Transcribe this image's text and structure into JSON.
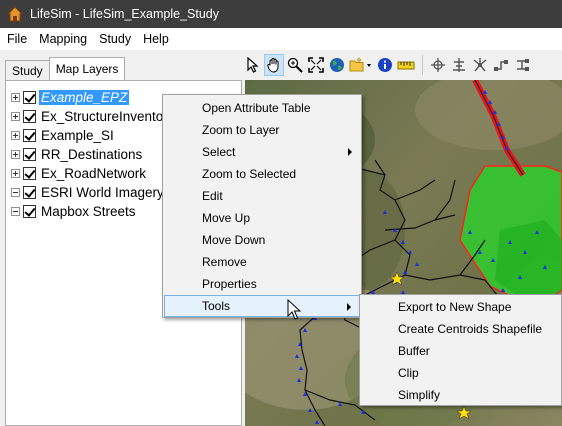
{
  "window": {
    "title": "LifeSim - LifeSim_Example_Study"
  },
  "menubar": {
    "items": [
      "File",
      "Mapping",
      "Study",
      "Help"
    ]
  },
  "tabs": [
    {
      "label": "Study",
      "active": false
    },
    {
      "label": "Map Layers",
      "active": true
    }
  ],
  "toolbar": {
    "tools": [
      "select-arrow-icon",
      "pan-hand-icon",
      "zoom-in-icon",
      "zoom-extent-icon",
      "globe-icon",
      "add-layer-icon",
      "info-icon",
      "measure-ruler-icon",
      "crosshair-icon",
      "flow-icon",
      "burst-icon",
      "route-icon",
      "network-icon"
    ],
    "selected_tool": "pan-hand-icon"
  },
  "layers": [
    {
      "label": "Example_EPZ",
      "checked": true,
      "expanded": false,
      "selected": true
    },
    {
      "label": "Ex_StructureInventory",
      "checked": true,
      "expanded": false,
      "selected": false
    },
    {
      "label": "Example_SI",
      "checked": true,
      "expanded": false,
      "selected": false
    },
    {
      "label": "RR_Destinations",
      "checked": true,
      "expanded": false,
      "selected": false
    },
    {
      "label": "Ex_RoadNetwork",
      "checked": true,
      "expanded": false,
      "selected": false
    },
    {
      "label": "ESRI World Imagery",
      "checked": true,
      "expanded": true,
      "selected": false
    },
    {
      "label": "Mapbox Streets",
      "checked": true,
      "expanded": true,
      "selected": false
    }
  ],
  "context_menu": {
    "items": [
      {
        "label": "Open Attribute Table",
        "submenu": false
      },
      {
        "label": "Zoom to Layer",
        "submenu": false
      },
      {
        "label": "Select",
        "submenu": true
      },
      {
        "label": "Zoom to Selected",
        "submenu": false
      },
      {
        "label": "Edit",
        "submenu": false
      },
      {
        "label": "Move Up",
        "submenu": false
      },
      {
        "label": "Move Down",
        "submenu": false
      },
      {
        "label": "Remove",
        "submenu": false
      },
      {
        "label": "Properties",
        "submenu": false
      },
      {
        "label": "Tools",
        "submenu": true,
        "hovered": true
      }
    ]
  },
  "tools_submenu": {
    "items": [
      "Export to New Shape",
      "Create Centroids Shapefile",
      "Buffer",
      "Clip",
      "Simplify"
    ]
  },
  "colors": {
    "titlebar": "#3d3d3d",
    "selection": "#3399ff",
    "epz_fill": "#2ecc2e",
    "epz_border": "#ff2020",
    "road_red": "#e8141b",
    "structure_blue": "#1a2ee8",
    "destination_star": "#ffe000"
  }
}
